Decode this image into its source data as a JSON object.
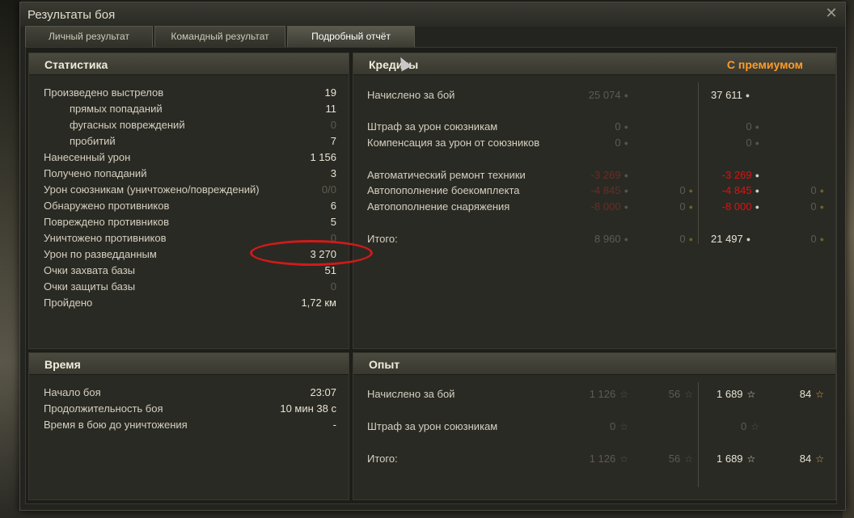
{
  "window": {
    "title": "Результаты боя"
  },
  "tabs": [
    {
      "label": "Личный результат"
    },
    {
      "label": "Командный результат"
    },
    {
      "label": "Подробный отчёт"
    }
  ],
  "stats": {
    "title": "Статистика",
    "rows": [
      {
        "label": "Произведено выстрелов",
        "value": "19"
      },
      {
        "label": "прямых попаданий",
        "value": "11"
      },
      {
        "label": "фугасных повреждений",
        "value": "0"
      },
      {
        "label": "пробитий",
        "value": "7"
      },
      {
        "label": "Нанесенный урон",
        "value": "1 156"
      },
      {
        "label": "Получено попаданий",
        "value": "3"
      },
      {
        "label": "Урон союзникам (уничтожено/повреждений)",
        "value": "0/0"
      },
      {
        "label": "Обнаружено противников",
        "value": "6"
      },
      {
        "label": "Повреждено противников",
        "value": "5"
      },
      {
        "label": "Уничтожено противников",
        "value": "0"
      },
      {
        "label": "Урон по разведданным",
        "value": "3 270"
      },
      {
        "label": "Очки захвата базы",
        "value": "51"
      },
      {
        "label": "Очки защиты базы",
        "value": "0"
      },
      {
        "label": "Пройдено",
        "value": "1,72 км"
      }
    ]
  },
  "credits": {
    "title": "Кредиты",
    "premium_title": "С премиумом",
    "rows": [
      {
        "label": "Начислено за бой",
        "base": "25 074",
        "premium": "37 611"
      },
      {
        "label": "Штраф за урон союзникам",
        "base": "0",
        "premium": "0"
      },
      {
        "label": "Компенсация за урон от союзников",
        "base": "0",
        "premium": "0"
      },
      {
        "label": "Автоматический ремонт техники",
        "base": "-3 269",
        "premium": "-3 269"
      },
      {
        "label": "Автопополнение боекомплекта",
        "base": "-4 845",
        "base_gold": "0",
        "premium": "-4 845",
        "premium_gold": "0"
      },
      {
        "label": "Автопополнение снаряжения",
        "base": "-8 000",
        "base_gold": "0",
        "premium": "-8 000",
        "premium_gold": "0"
      },
      {
        "label": "Итого:",
        "base": "8 960",
        "base_gold": "0",
        "premium": "21 497",
        "premium_gold": "0"
      }
    ]
  },
  "time": {
    "title": "Время",
    "rows": [
      {
        "label": "Начало боя",
        "value": "23:07"
      },
      {
        "label": "Продолжительность боя",
        "value": "10 мин 38 с"
      },
      {
        "label": "Время в бою до уничтожения",
        "value": "-"
      }
    ]
  },
  "experience": {
    "title": "Опыт",
    "rows": [
      {
        "label": "Начислено за бой",
        "base": "1 126",
        "base_free": "56",
        "premium": "1 689",
        "premium_free": "84"
      },
      {
        "label": "Штраф за урон союзникам",
        "base": "0",
        "premium": "0"
      },
      {
        "label": "Итого:",
        "base": "1 126",
        "base_free": "56",
        "premium": "1 689",
        "premium_free": "84"
      }
    ]
  },
  "icons": {
    "close": "close-icon",
    "credit_coin": "credit-coin-icon",
    "gold_coin": "gold-coin-icon",
    "exp_star": "star-icon"
  },
  "colors": {
    "premium_accent": "#ff9b28",
    "negative": "#e01010",
    "annotation": "#d01a1a"
  }
}
